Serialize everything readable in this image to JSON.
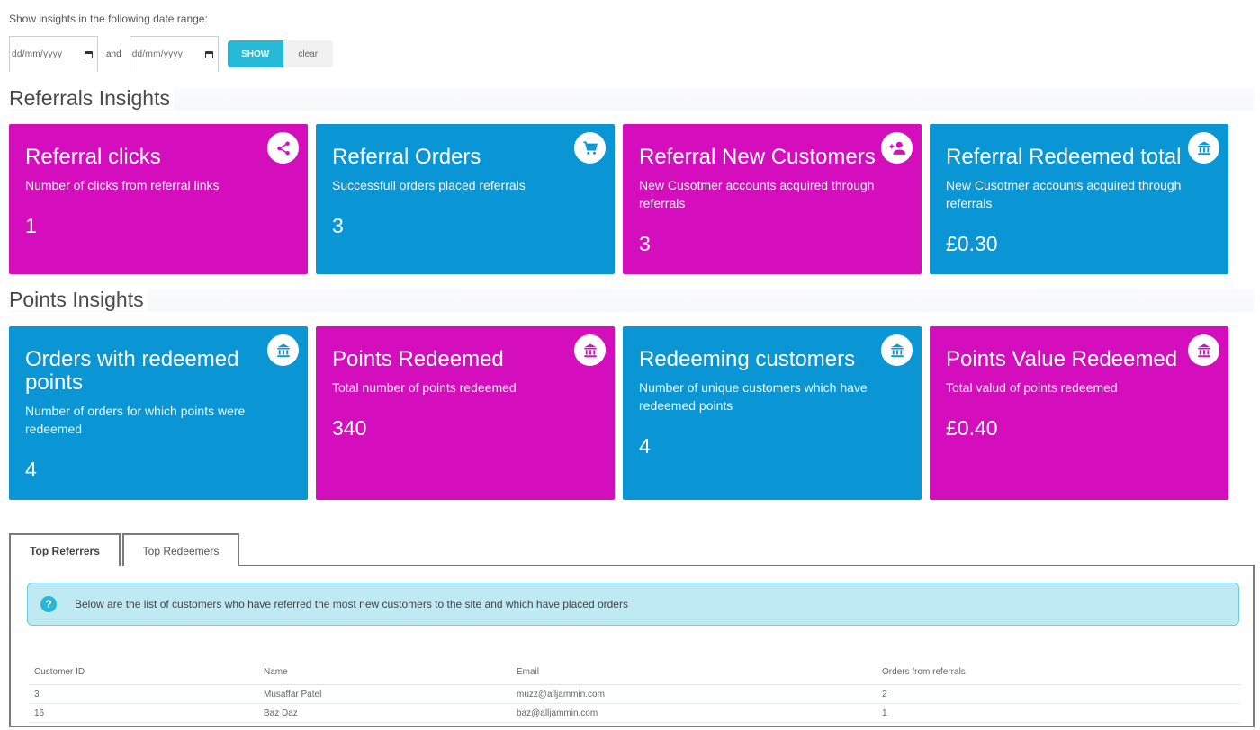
{
  "date_range": {
    "label": "Show insights in the following date range:",
    "from_placeholder": "dd/mm/yyyy",
    "and_label": "and",
    "to_placeholder": "dd/mm/yyyy",
    "show_label": "SHOW",
    "clear_label": "clear"
  },
  "colors": {
    "magenta": "#d40ebd",
    "blue": "#0a96d4",
    "accent": "#25b9d7",
    "alert_bg": "#bfe9f3"
  },
  "referrals": {
    "title": "Referrals Insights",
    "cards": [
      {
        "title": "Referral clicks",
        "description": "Number of clicks from referral links",
        "value": "1",
        "icon": "share-icon",
        "color": "magenta"
      },
      {
        "title": "Referral Orders",
        "description": "Successfull orders placed referrals",
        "value": "3",
        "icon": "cart-icon",
        "color": "blue"
      },
      {
        "title": "Referral New Customers",
        "description": "New Cusotmer accounts acquired through referrals",
        "value": "3",
        "icon": "add-user-icon",
        "color": "magenta"
      },
      {
        "title": "Referral Redeemed total",
        "description": "New Cusotmer accounts acquired through referrals",
        "value": "£0.30",
        "icon": "bank-icon",
        "color": "blue"
      }
    ]
  },
  "points": {
    "title": "Points Insights",
    "cards": [
      {
        "title": "Orders with redeemed points",
        "description": "Number of orders for which points were redeemed",
        "value": "4",
        "icon": "bank-icon",
        "color": "blue"
      },
      {
        "title": "Points Redeemed",
        "description": "Total number of points redeemed",
        "value": "340",
        "icon": "bank-icon",
        "color": "magenta"
      },
      {
        "title": "Redeeming customers",
        "description": "Number of unique customers which have redeemed points",
        "value": "4",
        "icon": "bank-icon",
        "color": "blue"
      },
      {
        "title": "Points Value Redeemed",
        "description": "Total valud of points redeemed",
        "value": "£0.40",
        "icon": "bank-icon",
        "color": "magenta"
      }
    ]
  },
  "tabs": [
    {
      "label": "Top Referrers",
      "active": true
    },
    {
      "label": "Top Redeemers",
      "active": false
    }
  ],
  "top_referrers": {
    "info": "Below are the list of customers who have referred the most new customers to the site and which have placed orders",
    "columns": [
      "Customer ID",
      "Name",
      "Email",
      "Orders from referrals"
    ],
    "rows": [
      [
        "3",
        "Musaffar Patel",
        "muzz@alljammin.com",
        "2"
      ],
      [
        "16",
        "Baz Daz",
        "baz@alljammin.com",
        "1"
      ]
    ]
  }
}
